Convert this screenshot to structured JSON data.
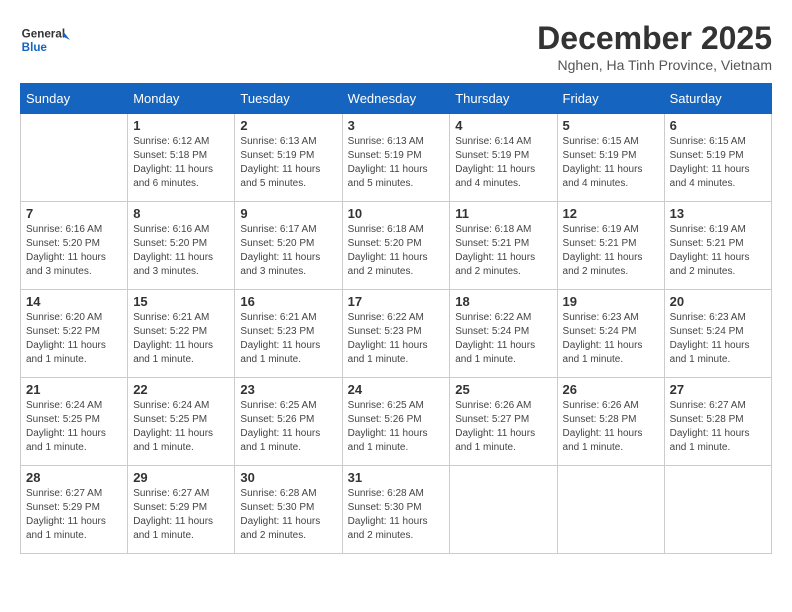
{
  "logo": {
    "line1": "General",
    "line2": "Blue"
  },
  "title": "December 2025",
  "subtitle": "Nghen, Ha Tinh Province, Vietnam",
  "weekdays": [
    "Sunday",
    "Monday",
    "Tuesday",
    "Wednesday",
    "Thursday",
    "Friday",
    "Saturday"
  ],
  "weeks": [
    [
      {
        "day": "",
        "info": ""
      },
      {
        "day": "1",
        "info": "Sunrise: 6:12 AM\nSunset: 5:18 PM\nDaylight: 11 hours\nand 6 minutes."
      },
      {
        "day": "2",
        "info": "Sunrise: 6:13 AM\nSunset: 5:19 PM\nDaylight: 11 hours\nand 5 minutes."
      },
      {
        "day": "3",
        "info": "Sunrise: 6:13 AM\nSunset: 5:19 PM\nDaylight: 11 hours\nand 5 minutes."
      },
      {
        "day": "4",
        "info": "Sunrise: 6:14 AM\nSunset: 5:19 PM\nDaylight: 11 hours\nand 4 minutes."
      },
      {
        "day": "5",
        "info": "Sunrise: 6:15 AM\nSunset: 5:19 PM\nDaylight: 11 hours\nand 4 minutes."
      },
      {
        "day": "6",
        "info": "Sunrise: 6:15 AM\nSunset: 5:19 PM\nDaylight: 11 hours\nand 4 minutes."
      }
    ],
    [
      {
        "day": "7",
        "info": "Sunrise: 6:16 AM\nSunset: 5:20 PM\nDaylight: 11 hours\nand 3 minutes."
      },
      {
        "day": "8",
        "info": "Sunrise: 6:16 AM\nSunset: 5:20 PM\nDaylight: 11 hours\nand 3 minutes."
      },
      {
        "day": "9",
        "info": "Sunrise: 6:17 AM\nSunset: 5:20 PM\nDaylight: 11 hours\nand 3 minutes."
      },
      {
        "day": "10",
        "info": "Sunrise: 6:18 AM\nSunset: 5:20 PM\nDaylight: 11 hours\nand 2 minutes."
      },
      {
        "day": "11",
        "info": "Sunrise: 6:18 AM\nSunset: 5:21 PM\nDaylight: 11 hours\nand 2 minutes."
      },
      {
        "day": "12",
        "info": "Sunrise: 6:19 AM\nSunset: 5:21 PM\nDaylight: 11 hours\nand 2 minutes."
      },
      {
        "day": "13",
        "info": "Sunrise: 6:19 AM\nSunset: 5:21 PM\nDaylight: 11 hours\nand 2 minutes."
      }
    ],
    [
      {
        "day": "14",
        "info": "Sunrise: 6:20 AM\nSunset: 5:22 PM\nDaylight: 11 hours\nand 1 minute."
      },
      {
        "day": "15",
        "info": "Sunrise: 6:21 AM\nSunset: 5:22 PM\nDaylight: 11 hours\nand 1 minute."
      },
      {
        "day": "16",
        "info": "Sunrise: 6:21 AM\nSunset: 5:23 PM\nDaylight: 11 hours\nand 1 minute."
      },
      {
        "day": "17",
        "info": "Sunrise: 6:22 AM\nSunset: 5:23 PM\nDaylight: 11 hours\nand 1 minute."
      },
      {
        "day": "18",
        "info": "Sunrise: 6:22 AM\nSunset: 5:24 PM\nDaylight: 11 hours\nand 1 minute."
      },
      {
        "day": "19",
        "info": "Sunrise: 6:23 AM\nSunset: 5:24 PM\nDaylight: 11 hours\nand 1 minute."
      },
      {
        "day": "20",
        "info": "Sunrise: 6:23 AM\nSunset: 5:24 PM\nDaylight: 11 hours\nand 1 minute."
      }
    ],
    [
      {
        "day": "21",
        "info": "Sunrise: 6:24 AM\nSunset: 5:25 PM\nDaylight: 11 hours\nand 1 minute."
      },
      {
        "day": "22",
        "info": "Sunrise: 6:24 AM\nSunset: 5:25 PM\nDaylight: 11 hours\nand 1 minute."
      },
      {
        "day": "23",
        "info": "Sunrise: 6:25 AM\nSunset: 5:26 PM\nDaylight: 11 hours\nand 1 minute."
      },
      {
        "day": "24",
        "info": "Sunrise: 6:25 AM\nSunset: 5:26 PM\nDaylight: 11 hours\nand 1 minute."
      },
      {
        "day": "25",
        "info": "Sunrise: 6:26 AM\nSunset: 5:27 PM\nDaylight: 11 hours\nand 1 minute."
      },
      {
        "day": "26",
        "info": "Sunrise: 6:26 AM\nSunset: 5:28 PM\nDaylight: 11 hours\nand 1 minute."
      },
      {
        "day": "27",
        "info": "Sunrise: 6:27 AM\nSunset: 5:28 PM\nDaylight: 11 hours\nand 1 minute."
      }
    ],
    [
      {
        "day": "28",
        "info": "Sunrise: 6:27 AM\nSunset: 5:29 PM\nDaylight: 11 hours\nand 1 minute."
      },
      {
        "day": "29",
        "info": "Sunrise: 6:27 AM\nSunset: 5:29 PM\nDaylight: 11 hours\nand 1 minute."
      },
      {
        "day": "30",
        "info": "Sunrise: 6:28 AM\nSunset: 5:30 PM\nDaylight: 11 hours\nand 2 minutes."
      },
      {
        "day": "31",
        "info": "Sunrise: 6:28 AM\nSunset: 5:30 PM\nDaylight: 11 hours\nand 2 minutes."
      },
      {
        "day": "",
        "info": ""
      },
      {
        "day": "",
        "info": ""
      },
      {
        "day": "",
        "info": ""
      }
    ]
  ]
}
